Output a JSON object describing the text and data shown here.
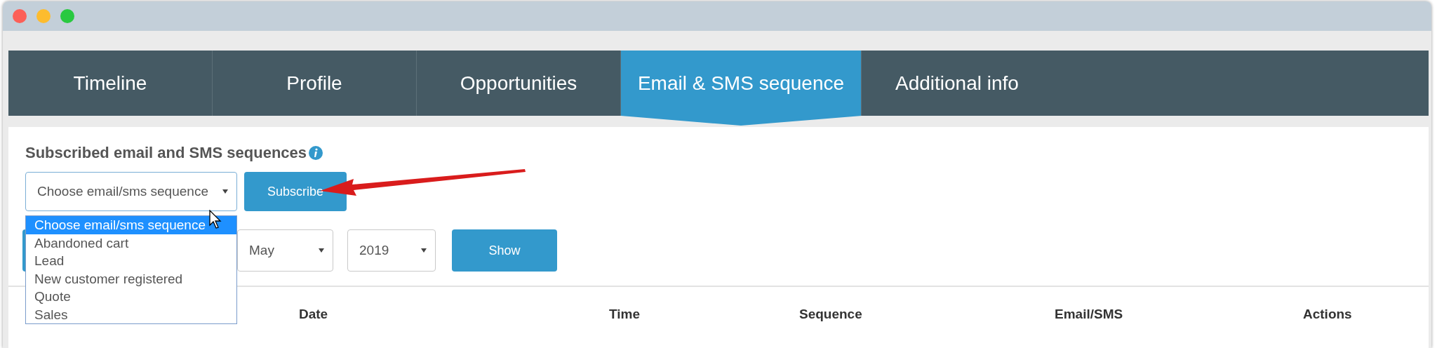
{
  "tabs": [
    {
      "label": "Timeline",
      "selected": false
    },
    {
      "label": "Profile",
      "selected": false
    },
    {
      "label": "Opportunities",
      "selected": false
    },
    {
      "label": "Email & SMS sequence",
      "selected": true
    },
    {
      "label": "Additional info",
      "selected": false
    }
  ],
  "section": {
    "title": "Subscribed email and SMS sequences"
  },
  "sequence_select": {
    "value": "Choose email/sms sequence",
    "expanded": true,
    "options": [
      {
        "label": "Choose email/sms sequence",
        "selected": true
      },
      {
        "label": "Abandoned cart",
        "selected": false
      },
      {
        "label": "Lead",
        "selected": false
      },
      {
        "label": "New customer registered",
        "selected": false
      },
      {
        "label": "Quote",
        "selected": false
      },
      {
        "label": "Sales",
        "selected": false
      }
    ]
  },
  "subscribe_button": "Subscribe",
  "filters": {
    "month": "May",
    "year": "2019",
    "show_button": "Show"
  },
  "table": {
    "columns": [
      "Date",
      "Time",
      "Sequence",
      "Email/SMS",
      "Actions"
    ]
  }
}
